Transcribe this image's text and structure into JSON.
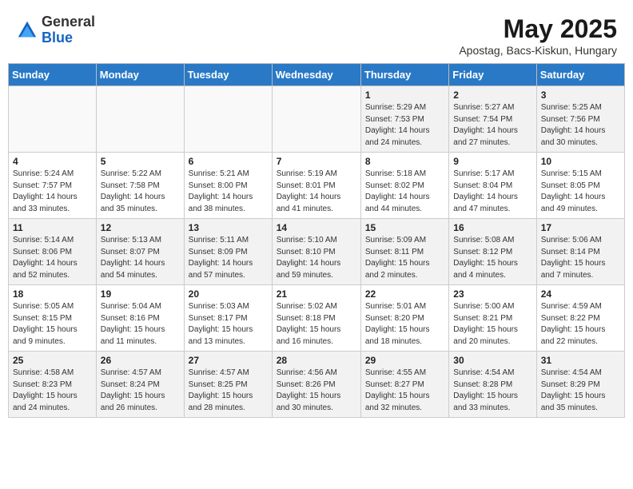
{
  "header": {
    "logo_general": "General",
    "logo_blue": "Blue",
    "month_title": "May 2025",
    "subtitle": "Apostag, Bacs-Kiskun, Hungary"
  },
  "weekdays": [
    "Sunday",
    "Monday",
    "Tuesday",
    "Wednesday",
    "Thursday",
    "Friday",
    "Saturday"
  ],
  "weeks": [
    [
      {
        "day": "",
        "info": ""
      },
      {
        "day": "",
        "info": ""
      },
      {
        "day": "",
        "info": ""
      },
      {
        "day": "",
        "info": ""
      },
      {
        "day": "1",
        "info": "Sunrise: 5:29 AM\nSunset: 7:53 PM\nDaylight: 14 hours\nand 24 minutes."
      },
      {
        "day": "2",
        "info": "Sunrise: 5:27 AM\nSunset: 7:54 PM\nDaylight: 14 hours\nand 27 minutes."
      },
      {
        "day": "3",
        "info": "Sunrise: 5:25 AM\nSunset: 7:56 PM\nDaylight: 14 hours\nand 30 minutes."
      }
    ],
    [
      {
        "day": "4",
        "info": "Sunrise: 5:24 AM\nSunset: 7:57 PM\nDaylight: 14 hours\nand 33 minutes."
      },
      {
        "day": "5",
        "info": "Sunrise: 5:22 AM\nSunset: 7:58 PM\nDaylight: 14 hours\nand 35 minutes."
      },
      {
        "day": "6",
        "info": "Sunrise: 5:21 AM\nSunset: 8:00 PM\nDaylight: 14 hours\nand 38 minutes."
      },
      {
        "day": "7",
        "info": "Sunrise: 5:19 AM\nSunset: 8:01 PM\nDaylight: 14 hours\nand 41 minutes."
      },
      {
        "day": "8",
        "info": "Sunrise: 5:18 AM\nSunset: 8:02 PM\nDaylight: 14 hours\nand 44 minutes."
      },
      {
        "day": "9",
        "info": "Sunrise: 5:17 AM\nSunset: 8:04 PM\nDaylight: 14 hours\nand 47 minutes."
      },
      {
        "day": "10",
        "info": "Sunrise: 5:15 AM\nSunset: 8:05 PM\nDaylight: 14 hours\nand 49 minutes."
      }
    ],
    [
      {
        "day": "11",
        "info": "Sunrise: 5:14 AM\nSunset: 8:06 PM\nDaylight: 14 hours\nand 52 minutes."
      },
      {
        "day": "12",
        "info": "Sunrise: 5:13 AM\nSunset: 8:07 PM\nDaylight: 14 hours\nand 54 minutes."
      },
      {
        "day": "13",
        "info": "Sunrise: 5:11 AM\nSunset: 8:09 PM\nDaylight: 14 hours\nand 57 minutes."
      },
      {
        "day": "14",
        "info": "Sunrise: 5:10 AM\nSunset: 8:10 PM\nDaylight: 14 hours\nand 59 minutes."
      },
      {
        "day": "15",
        "info": "Sunrise: 5:09 AM\nSunset: 8:11 PM\nDaylight: 15 hours\nand 2 minutes."
      },
      {
        "day": "16",
        "info": "Sunrise: 5:08 AM\nSunset: 8:12 PM\nDaylight: 15 hours\nand 4 minutes."
      },
      {
        "day": "17",
        "info": "Sunrise: 5:06 AM\nSunset: 8:14 PM\nDaylight: 15 hours\nand 7 minutes."
      }
    ],
    [
      {
        "day": "18",
        "info": "Sunrise: 5:05 AM\nSunset: 8:15 PM\nDaylight: 15 hours\nand 9 minutes."
      },
      {
        "day": "19",
        "info": "Sunrise: 5:04 AM\nSunset: 8:16 PM\nDaylight: 15 hours\nand 11 minutes."
      },
      {
        "day": "20",
        "info": "Sunrise: 5:03 AM\nSunset: 8:17 PM\nDaylight: 15 hours\nand 13 minutes."
      },
      {
        "day": "21",
        "info": "Sunrise: 5:02 AM\nSunset: 8:18 PM\nDaylight: 15 hours\nand 16 minutes."
      },
      {
        "day": "22",
        "info": "Sunrise: 5:01 AM\nSunset: 8:20 PM\nDaylight: 15 hours\nand 18 minutes."
      },
      {
        "day": "23",
        "info": "Sunrise: 5:00 AM\nSunset: 8:21 PM\nDaylight: 15 hours\nand 20 minutes."
      },
      {
        "day": "24",
        "info": "Sunrise: 4:59 AM\nSunset: 8:22 PM\nDaylight: 15 hours\nand 22 minutes."
      }
    ],
    [
      {
        "day": "25",
        "info": "Sunrise: 4:58 AM\nSunset: 8:23 PM\nDaylight: 15 hours\nand 24 minutes."
      },
      {
        "day": "26",
        "info": "Sunrise: 4:57 AM\nSunset: 8:24 PM\nDaylight: 15 hours\nand 26 minutes."
      },
      {
        "day": "27",
        "info": "Sunrise: 4:57 AM\nSunset: 8:25 PM\nDaylight: 15 hours\nand 28 minutes."
      },
      {
        "day": "28",
        "info": "Sunrise: 4:56 AM\nSunset: 8:26 PM\nDaylight: 15 hours\nand 30 minutes."
      },
      {
        "day": "29",
        "info": "Sunrise: 4:55 AM\nSunset: 8:27 PM\nDaylight: 15 hours\nand 32 minutes."
      },
      {
        "day": "30",
        "info": "Sunrise: 4:54 AM\nSunset: 8:28 PM\nDaylight: 15 hours\nand 33 minutes."
      },
      {
        "day": "31",
        "info": "Sunrise: 4:54 AM\nSunset: 8:29 PM\nDaylight: 15 hours\nand 35 minutes."
      }
    ]
  ]
}
